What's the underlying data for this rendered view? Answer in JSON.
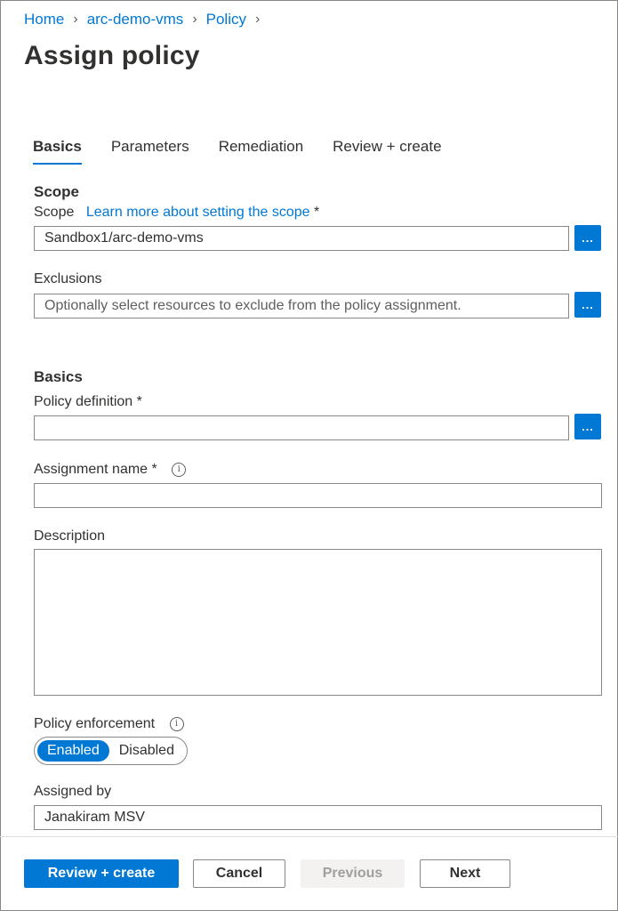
{
  "breadcrumb": [
    {
      "label": "Home"
    },
    {
      "label": "arc-demo-vms"
    },
    {
      "label": "Policy"
    }
  ],
  "page_title": "Assign policy",
  "tabs": [
    {
      "label": "Basics",
      "active": true
    },
    {
      "label": "Parameters"
    },
    {
      "label": "Remediation"
    },
    {
      "label": "Review + create"
    }
  ],
  "scope_section": {
    "title": "Scope",
    "scope_label": "Scope",
    "scope_link": "Learn more about setting the scope",
    "required_mark": "*",
    "scope_value": "Sandbox1/arc-demo-vms",
    "browse_label": "...",
    "exclusions_label": "Exclusions",
    "exclusions_placeholder": "Optionally select resources to exclude from the policy assignment."
  },
  "basics_section": {
    "title": "Basics",
    "policy_definition_label": "Policy definition *",
    "policy_definition_value": "",
    "assignment_name_label": "Assignment name *",
    "assignment_name_value": "",
    "info_glyph": "i",
    "description_label": "Description",
    "description_value": "",
    "enforcement_label": "Policy enforcement",
    "enforcement_options": [
      "Enabled",
      "Disabled"
    ],
    "enforcement_selected": "Enabled",
    "assigned_by_label": "Assigned by",
    "assigned_by_value": "Janakiram MSV"
  },
  "footer": {
    "review_create": "Review + create",
    "cancel": "Cancel",
    "previous": "Previous",
    "next": "Next"
  },
  "colors": {
    "accent": "#0078d4",
    "text": "#323130",
    "border": "#8a8886"
  }
}
